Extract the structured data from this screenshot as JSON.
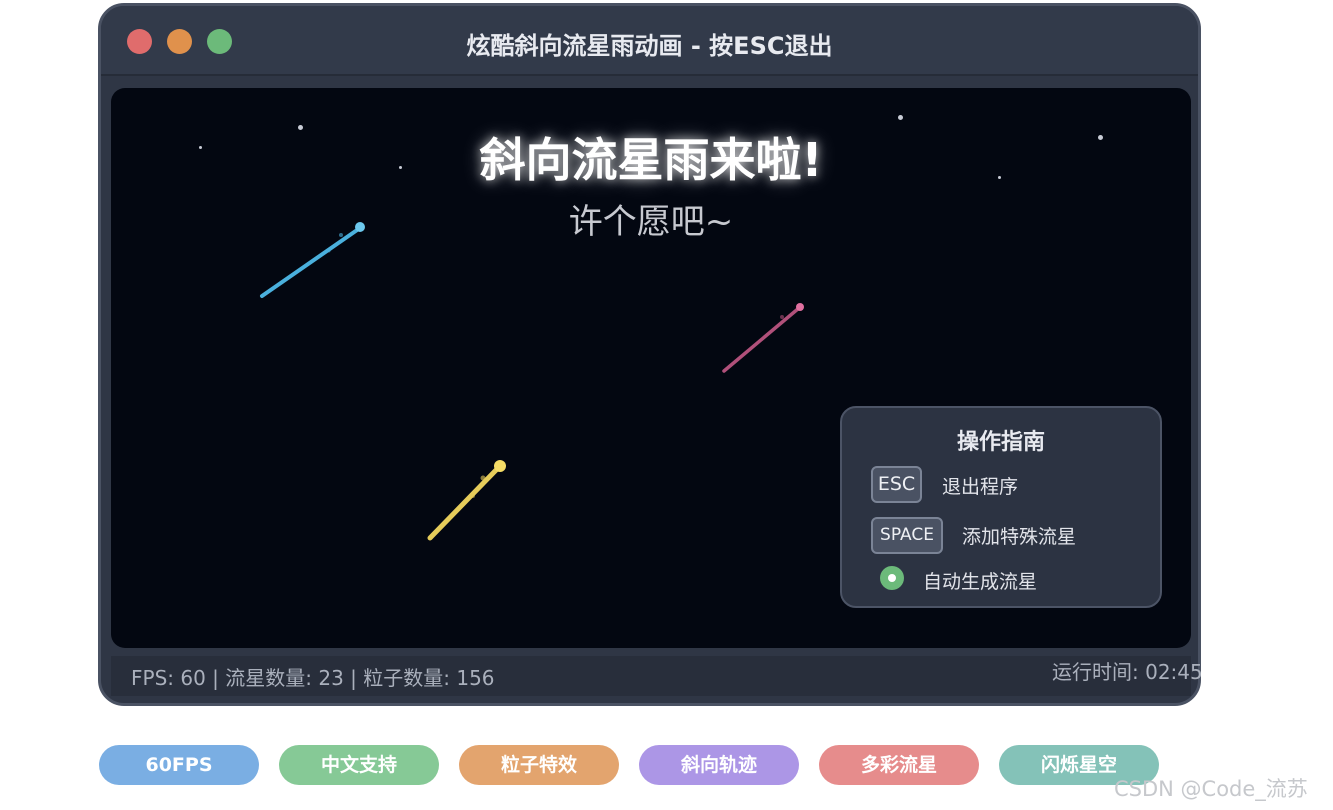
{
  "window": {
    "title": "炫酷斜向流星雨动画 - 按ESC退出",
    "traffic_lights": [
      "#e06c6c",
      "#e0914c",
      "#6cba7a"
    ]
  },
  "canvas": {
    "headline": "斜向流星雨来啦!",
    "subline": "许个愿吧~",
    "meteor_colors": [
      "#4ab0dd",
      "#b0507a",
      "#e6cc5a"
    ]
  },
  "guide": {
    "title": "操作指南",
    "items": [
      {
        "key": "ESC",
        "label": "退出程序"
      },
      {
        "key": "SPACE",
        "label": "添加特殊流星"
      },
      {
        "icon": "toggle-on-icon",
        "label": "自动生成流星"
      }
    ]
  },
  "status": {
    "left": "FPS: 60 | 流星数量: 23 | 粒子数量: 156",
    "right": "运行时间: 02:45"
  },
  "features": [
    {
      "label": "60FPS",
      "color": "#7aaee3"
    },
    {
      "label": "中文支持",
      "color": "#86c996"
    },
    {
      "label": "粒子特效",
      "color": "#e3a46e"
    },
    {
      "label": "斜向轨迹",
      "color": "#ac96e6"
    },
    {
      "label": "多彩流星",
      "color": "#e68c8c"
    },
    {
      "label": "闪烁星空",
      "color": "#84c2b8"
    }
  ],
  "watermark": "CSDN @Code_流苏"
}
